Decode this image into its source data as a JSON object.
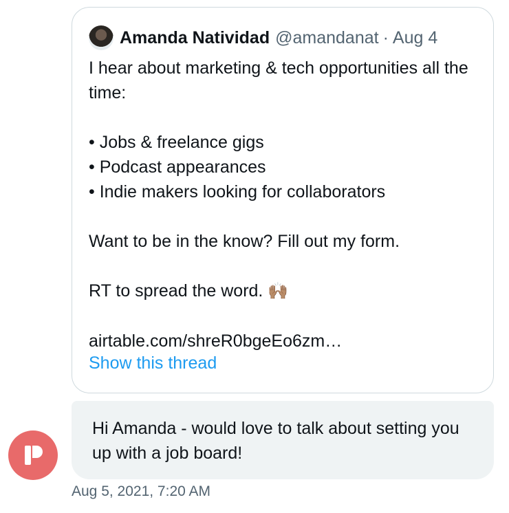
{
  "quoted_tweet": {
    "author_name": "Amanda Natividad",
    "handle": "@amandanat",
    "separator": "·",
    "date": "Aug 4",
    "lines": {
      "intro": "I hear about marketing & tech opportunities all the time:",
      "bullet1": "• Jobs & freelance gigs",
      "bullet2": "• Podcast appearances",
      "bullet3": "• Indie makers looking for collaborators",
      "cta": "Want to be in the know? Fill out my form.",
      "rt": "RT to spread the word.",
      "emoji": "🙌🏽",
      "link": "airtable.com/shreR0bgeEo6zm…"
    },
    "show_thread": "Show this thread"
  },
  "reply": {
    "message": "Hi Amanda - would love to talk about setting you up with a job board!",
    "timestamp": "Aug 5, 2021, 7:20 AM",
    "avatar_icon": "product-logo-icon",
    "avatar_color": "#e86a6a"
  },
  "colors": {
    "link_blue": "#1d9bf0",
    "muted_gray": "#536471",
    "bubble_bg": "#eff3f4",
    "card_border": "#cfd9de"
  }
}
